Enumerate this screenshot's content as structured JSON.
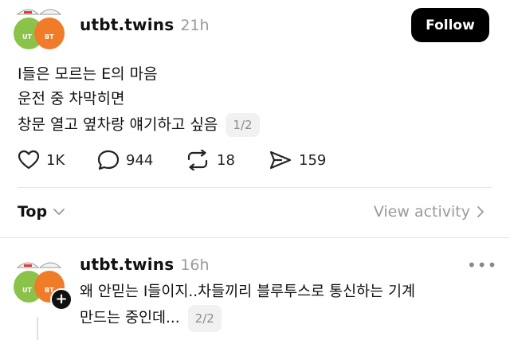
{
  "post": {
    "username": "utbt.twins",
    "time": "21h",
    "follow_label": "Follow",
    "lines": [
      "I들은 모르는 E의 마음",
      "운전 중 차막히면",
      "창문 열고 옆차랑 얘기하고 싶음"
    ],
    "pager": "1/2",
    "actions": {
      "likes": "1K",
      "comments": "944",
      "reposts": "18",
      "shares": "159"
    }
  },
  "sort": {
    "label": "Top",
    "view_activity": "View activity"
  },
  "reply": {
    "username": "utbt.twins",
    "time": "16h",
    "lines": [
      "왜 안믿는 I들이지..차들끼리 블루투스로 통신하는 기계",
      "만드는 중인데..."
    ],
    "pager": "2/2"
  },
  "avatar_text": {
    "left": "UT",
    "right": "BT"
  },
  "colors": {
    "follow_bg": "#000000",
    "avatar_green": "#8bc34a",
    "avatar_orange": "#f07c2a"
  },
  "icons": [
    "heart-icon",
    "comment-icon",
    "repost-icon",
    "share-icon",
    "chevron-down-icon",
    "chevron-right-icon",
    "more-icon",
    "plus-icon"
  ]
}
